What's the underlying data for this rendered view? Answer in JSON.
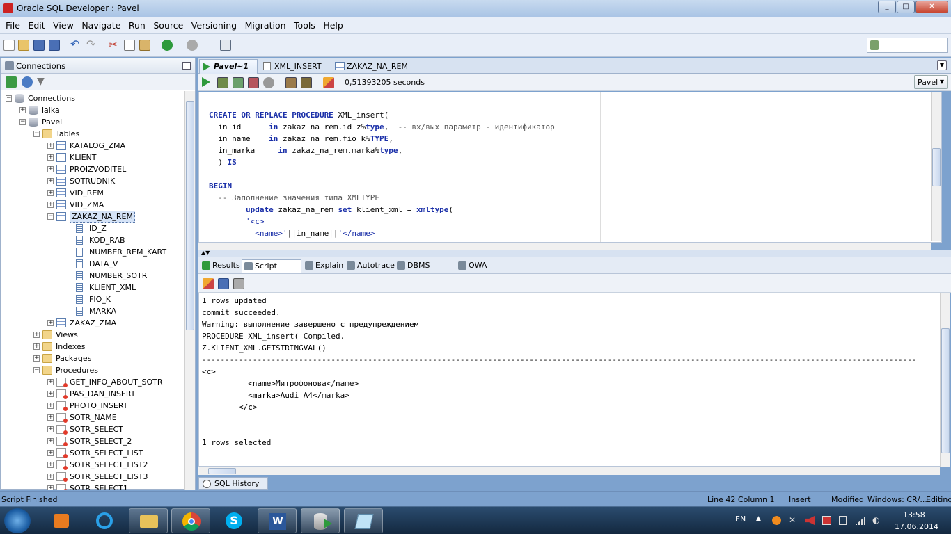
{
  "window": {
    "title": "Oracle SQL Developer : Pavel",
    "minimize": "_",
    "maximize": "□",
    "close": "✕"
  },
  "menu": [
    "File",
    "Edit",
    "View",
    "Navigate",
    "Run",
    "Source",
    "Versioning",
    "Migration",
    "Tools",
    "Help"
  ],
  "connections_panel": {
    "title": "Connections",
    "tree": [
      {
        "label": "Connections",
        "level": 0,
        "icon": "connections-icon",
        "exp": "-"
      },
      {
        "label": "lalka",
        "level": 1,
        "icon": "database-icon",
        "exp": "+"
      },
      {
        "label": "Pavel",
        "level": 1,
        "icon": "database-icon",
        "exp": "-"
      },
      {
        "label": "Tables",
        "level": 2,
        "icon": "folder-icon",
        "exp": "-"
      },
      {
        "label": "KATALOG_ZMA",
        "level": 3,
        "icon": "table-icon",
        "exp": "+"
      },
      {
        "label": "KLIENT",
        "level": 3,
        "icon": "table-icon",
        "exp": "+"
      },
      {
        "label": "PROIZVODITEL",
        "level": 3,
        "icon": "table-icon",
        "exp": "+"
      },
      {
        "label": "SOTRUDNIK",
        "level": 3,
        "icon": "table-icon",
        "exp": "+"
      },
      {
        "label": "VID_REM",
        "level": 3,
        "icon": "table-icon",
        "exp": "+"
      },
      {
        "label": "VID_ZMA",
        "level": 3,
        "icon": "table-icon",
        "exp": "+"
      },
      {
        "label": "ZAKAZ_NA_REM",
        "level": 3,
        "icon": "table-icon",
        "exp": "-",
        "selected": true
      },
      {
        "label": "ID_Z",
        "level": 4,
        "icon": "column-icon",
        "exp": ""
      },
      {
        "label": "KOD_RAB",
        "level": 4,
        "icon": "column-icon",
        "exp": ""
      },
      {
        "label": "NUMBER_REM_KART",
        "level": 4,
        "icon": "column-icon",
        "exp": ""
      },
      {
        "label": "DATA_V",
        "level": 4,
        "icon": "column-icon",
        "exp": ""
      },
      {
        "label": "NUMBER_SOTR",
        "level": 4,
        "icon": "column-icon",
        "exp": ""
      },
      {
        "label": "KLIENT_XML",
        "level": 4,
        "icon": "column-icon",
        "exp": ""
      },
      {
        "label": "FIO_K",
        "level": 4,
        "icon": "column-icon",
        "exp": ""
      },
      {
        "label": "MARKA",
        "level": 4,
        "icon": "column-icon",
        "exp": ""
      },
      {
        "label": "ZAKAZ_ZMA",
        "level": 3,
        "icon": "table-icon",
        "exp": "+"
      },
      {
        "label": "Views",
        "level": 2,
        "icon": "folder-icon",
        "exp": "+"
      },
      {
        "label": "Indexes",
        "level": 2,
        "icon": "folder-icon",
        "exp": "+"
      },
      {
        "label": "Packages",
        "level": 2,
        "icon": "folder-icon",
        "exp": "+"
      },
      {
        "label": "Procedures",
        "level": 2,
        "icon": "folder-icon",
        "exp": "-"
      },
      {
        "label": "GET_INFO_ABOUT_SOTR",
        "level": 3,
        "icon": "procedure-icon",
        "exp": "+"
      },
      {
        "label": "PAS_DAN_INSERT",
        "level": 3,
        "icon": "procedure-icon",
        "exp": "+"
      },
      {
        "label": "PHOTO_INSERT",
        "level": 3,
        "icon": "procedure-icon",
        "exp": "+"
      },
      {
        "label": "SOTR_NAME",
        "level": 3,
        "icon": "procedure-icon",
        "exp": "+"
      },
      {
        "label": "SOTR_SELECT",
        "level": 3,
        "icon": "procedure-icon",
        "exp": "+"
      },
      {
        "label": "SOTR_SELECT_2",
        "level": 3,
        "icon": "procedure-icon",
        "exp": "+"
      },
      {
        "label": "SOTR_SELECT_LIST",
        "level": 3,
        "icon": "procedure-icon",
        "exp": "+"
      },
      {
        "label": "SOTR_SELECT_LIST2",
        "level": 3,
        "icon": "procedure-icon",
        "exp": "+"
      },
      {
        "label": "SOTR_SELECT_LIST3",
        "level": 3,
        "icon": "procedure-icon",
        "exp": "+"
      },
      {
        "label": "SOTR_SELECT1",
        "level": 3,
        "icon": "procedure-icon",
        "exp": "+"
      }
    ]
  },
  "editor_tabs": [
    {
      "label": "Pavel~1",
      "active": true,
      "icon": "worksheet-icon"
    },
    {
      "label": "XML_INSERT",
      "active": false,
      "icon": "procedure-icon"
    },
    {
      "label": "ZAKAZ_NA_REM",
      "active": false,
      "icon": "table-icon"
    }
  ],
  "editor_toolbar": {
    "timing": "0,51393205 seconds",
    "connection": "Pavel"
  },
  "editor": {
    "lines": [
      [
        {
          "t": "CREATE OR REPLACE PROCEDURE ",
          "k": "kw"
        },
        {
          "t": "XML_insert(",
          "k": ""
        }
      ],
      [
        {
          "t": "  in_id      ",
          "k": ""
        },
        {
          "t": "in ",
          "k": "kw"
        },
        {
          "t": "zakaz_na_rem.id_z%",
          "k": ""
        },
        {
          "t": "type",
          "k": "kw"
        },
        {
          "t": ",  ",
          "k": ""
        },
        {
          "t": "-- вх/вых параметр - идентификатор",
          "k": "cm"
        }
      ],
      [
        {
          "t": "  in_name    ",
          "k": ""
        },
        {
          "t": "in ",
          "k": "kw"
        },
        {
          "t": "zakaz_na_rem.fio_k%",
          "k": ""
        },
        {
          "t": "TYPE",
          "k": "kw"
        },
        {
          "t": ",",
          "k": ""
        }
      ],
      [
        {
          "t": "  in_marka     ",
          "k": ""
        },
        {
          "t": "in ",
          "k": "kw"
        },
        {
          "t": "zakaz_na_rem.marka%",
          "k": ""
        },
        {
          "t": "type",
          "k": "kw"
        },
        {
          "t": ",",
          "k": ""
        }
      ],
      [
        {
          "t": "  ) ",
          "k": ""
        },
        {
          "t": "IS",
          "k": "kw"
        }
      ],
      [
        {
          "t": "",
          "k": ""
        }
      ],
      [
        {
          "t": "BEGIN",
          "k": "kw"
        }
      ],
      [
        {
          "t": "  -- Заполнение значения типа XMLTYPE",
          "k": "cm"
        }
      ],
      [
        {
          "t": "        ",
          "k": ""
        },
        {
          "t": "update ",
          "k": "kw"
        },
        {
          "t": "zakaz_na_rem ",
          "k": ""
        },
        {
          "t": "set ",
          "k": "kw"
        },
        {
          "t": "klient_xml = ",
          "k": ""
        },
        {
          "t": "xmltype",
          "k": "kw"
        },
        {
          "t": "(",
          "k": ""
        }
      ],
      [
        {
          "t": "        '<c>",
          "k": "str"
        }
      ],
      [
        {
          "t": "          <name>'",
          "k": "str"
        },
        {
          "t": "||in_name||",
          "k": ""
        },
        {
          "t": "'</name>",
          "k": "str"
        }
      ]
    ]
  },
  "output_tabs": [
    {
      "label": "Results",
      "active": false,
      "icon": "results-icon"
    },
    {
      "label": "Script Output",
      "active": true,
      "icon": "script-output-icon"
    },
    {
      "label": "Explain",
      "active": false,
      "icon": "explain-icon"
    },
    {
      "label": "Autotrace",
      "active": false,
      "icon": "autotrace-icon"
    },
    {
      "label": "DBMS Output",
      "active": false,
      "icon": "dbms-output-icon"
    },
    {
      "label": "OWA Output",
      "active": false,
      "icon": "owa-output-icon"
    }
  ],
  "output": {
    "lines": [
      "1 rows updated",
      "commit succeeded.",
      "Warning: выполнение завершено с предупреждением",
      "PROCEDURE XML_insert( Compiled.",
      "Z.KLIENT_XML.GETSTRINGVAL()",
      "-----------------------------------------------------------------------------------------------------------------------------------------------------------",
      "<c>",
      "          <name>Митрофонова</name>",
      "          <marka>Audi A4</marka>",
      "        </c>",
      "",
      "",
      "1 rows selected"
    ]
  },
  "sql_history": "SQL History",
  "status": {
    "left": "Script Finished",
    "position": "Line 42 Column 1",
    "mode": "Insert",
    "modified": "Modified",
    "line_endings": "Windows: CR/...",
    "editing": "Editing"
  },
  "taskbar": {
    "lang": "EN",
    "time": "13:58",
    "date": "17.06.2014",
    "apps": [
      "start-orb-icon",
      "media-player-icon",
      "internet-explorer-icon",
      "file-explorer-icon",
      "chrome-icon",
      "skype-icon",
      "word-icon",
      "sql-developer-icon",
      "notepad-icon"
    ]
  },
  "colors": {
    "accent": "#1a2fa8",
    "frame": "#7da2ce"
  }
}
